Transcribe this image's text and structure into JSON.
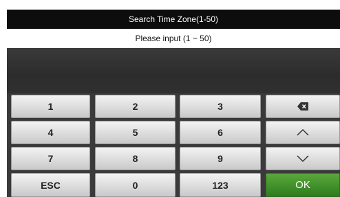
{
  "header": {
    "title": "Search Time Zone(1-50)"
  },
  "input": {
    "prompt": "Please input (1 ~ 50)"
  },
  "keypad": {
    "row1": [
      "1",
      "2",
      "3"
    ],
    "row2": [
      "4",
      "5",
      "6"
    ],
    "row3": [
      "7",
      "8",
      "9"
    ],
    "row4": [
      "ESC",
      "0",
      "123"
    ],
    "ok_label": "OK",
    "backspace_icon": "backspace-icon",
    "up_icon": "chevron-up-icon",
    "down_icon": "chevron-down-icon"
  },
  "colors": {
    "title_bar": "#0d0d0d",
    "ok_green": "#3f8f2a",
    "key_gray": "#dcdcdc"
  }
}
